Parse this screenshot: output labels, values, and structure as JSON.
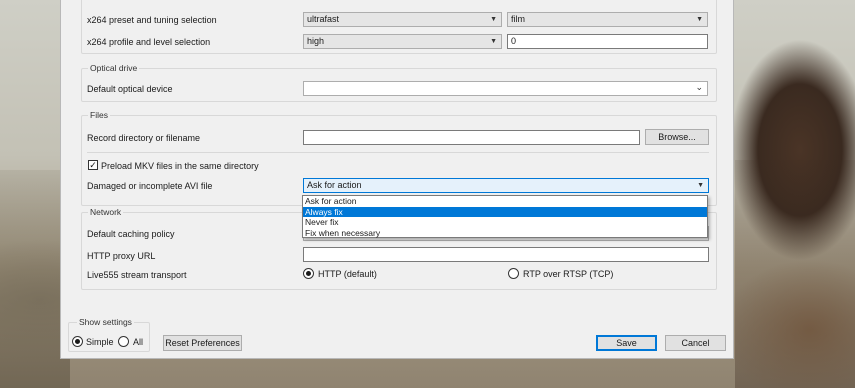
{
  "video": {
    "preset_label": "x264 preset and tuning selection",
    "preset_value": "ultrafast",
    "tuning_value": "film",
    "profile_label": "x264 profile and level selection",
    "profile_value": "high",
    "level_value": "0"
  },
  "optical": {
    "title": "Optical drive",
    "device_label": "Default optical device",
    "device_value": ""
  },
  "files": {
    "title": "Files",
    "record_label": "Record directory or filename",
    "record_value": "",
    "browse_label": "Browse...",
    "preload_label": "Preload MKV files in the same directory",
    "preload_checked": true,
    "avi_label": "Damaged or incomplete AVI file",
    "avi_value": "Ask for action",
    "avi_options": [
      "Ask for action",
      "Always fix",
      "Never fix",
      "Fix when necessary"
    ],
    "avi_highlighted": "Always fix"
  },
  "network": {
    "title": "Network",
    "caching_label": "Default caching policy",
    "proxy_label": "HTTP proxy URL",
    "proxy_value": "",
    "live555_label": "Live555 stream transport",
    "http_option": "HTTP (default)",
    "rtp_option": "RTP over RTSP (TCP)",
    "selected": "HTTP (default)"
  },
  "footer": {
    "show_settings_label": "Show settings",
    "simple_label": "Simple",
    "all_label": "All",
    "selected": "Simple",
    "reset_label": "Reset Preferences",
    "save_label": "Save",
    "cancel_label": "Cancel"
  },
  "icons": {
    "dropdown_arrow": "chevron-down-icon",
    "check": "check-icon"
  }
}
